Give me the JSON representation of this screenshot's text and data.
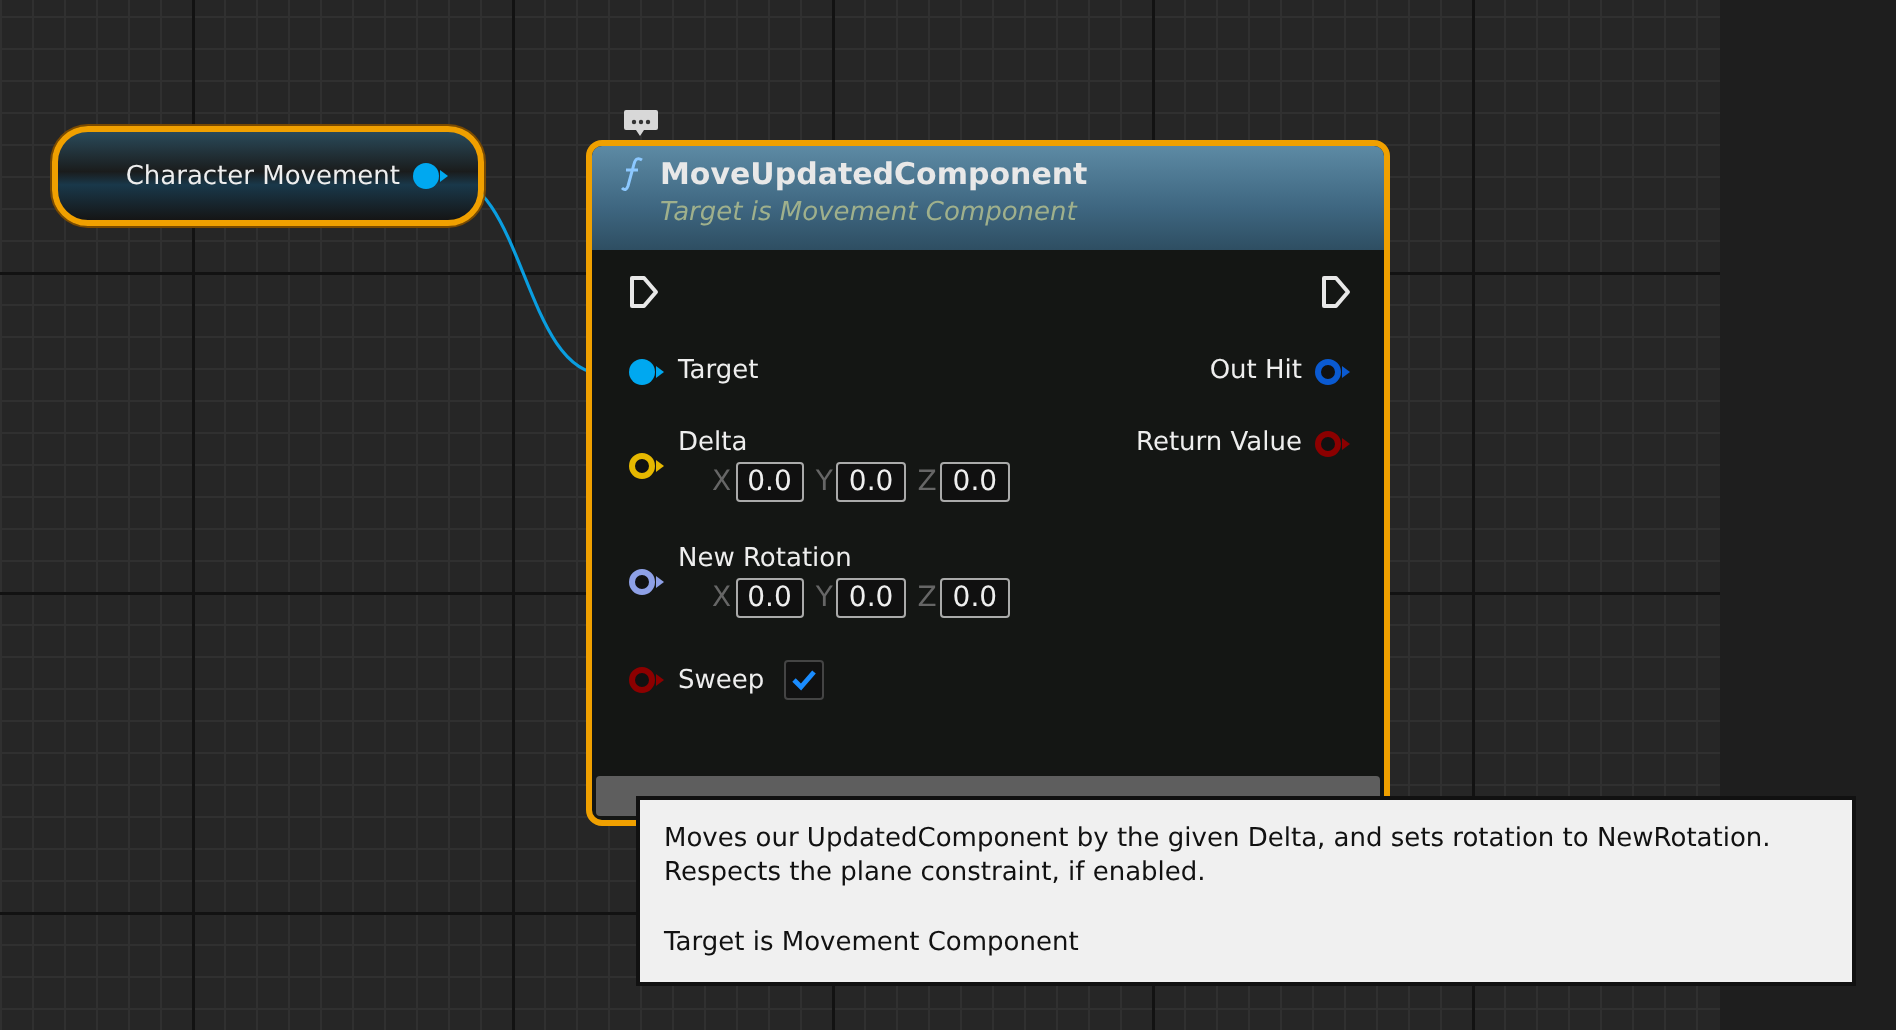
{
  "variable_node": {
    "label": "Character Movement",
    "selected": true,
    "pin": {
      "color": "#00a8f0",
      "connected": true
    }
  },
  "function_node": {
    "selected": true,
    "title": "MoveUpdatedComponent",
    "subtitle": "Target is Movement Component",
    "has_comment": true,
    "inputs": [
      {
        "kind": "exec",
        "connected": false
      },
      {
        "kind": "data",
        "label": "Target",
        "color": "#00a8f0",
        "connected": true
      },
      {
        "kind": "vector",
        "label": "Delta",
        "color": "#e6b800",
        "connected": false,
        "components": [
          {
            "axis": "X",
            "value": "0.0"
          },
          {
            "axis": "Y",
            "value": "0.0"
          },
          {
            "axis": "Z",
            "value": "0.0"
          }
        ]
      },
      {
        "kind": "vector",
        "label": "New Rotation",
        "color": "#8ea0e6",
        "connected": false,
        "components": [
          {
            "axis": "X",
            "value": "0.0"
          },
          {
            "axis": "Y",
            "value": "0.0"
          },
          {
            "axis": "Z",
            "value": "0.0"
          }
        ]
      },
      {
        "kind": "bool",
        "label": "Sweep",
        "color": "#8c0000",
        "connected": false,
        "checked": true
      }
    ],
    "outputs": [
      {
        "kind": "exec",
        "connected": false
      },
      {
        "kind": "data",
        "label": "Out Hit",
        "color": "#0a5ad2",
        "connected": false
      },
      {
        "kind": "data",
        "label": "Return Value",
        "color": "#8c0000",
        "connected": false
      }
    ]
  },
  "tooltip": {
    "paragraphs": [
      "Moves our UpdatedComponent by the given Delta, and sets rotation to NewRotation. Respects the plane constraint, if enabled.",
      "Target is Movement Component"
    ]
  }
}
